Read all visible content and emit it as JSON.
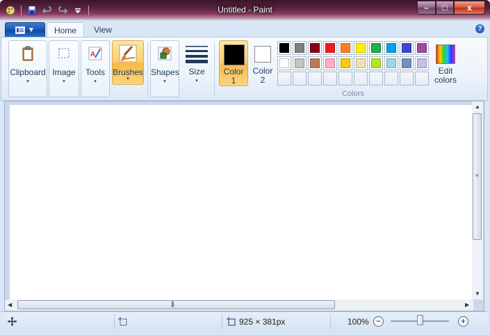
{
  "window": {
    "title": "Untitled - Paint"
  },
  "quick_access": {
    "items": [
      "paint-logo-icon",
      "save-icon",
      "undo-icon",
      "redo-icon",
      "customize-icon"
    ]
  },
  "window_controls": {
    "minimize": "–",
    "maximize": "□",
    "close": "x"
  },
  "ribbon_tabs": {
    "home": "Home",
    "view": "View"
  },
  "help_glyph": "?",
  "ribbon": {
    "clipboard": "Clipboard",
    "image": "Image",
    "tools": "Tools",
    "brushes": "Brushes",
    "shapes": "Shapes",
    "size": "Size",
    "color1": {
      "label": "Color",
      "num": "1",
      "value": "#000000"
    },
    "color2": {
      "label": "Color",
      "num": "2",
      "value": "#ffffff"
    },
    "colors_group": "Colors",
    "edit_colors": {
      "line1": "Edit",
      "line2": "colors"
    },
    "dropdown_glyph": "▾"
  },
  "palette": {
    "row1": [
      "#000000",
      "#7f7f7f",
      "#880015",
      "#ed1c24",
      "#ff7f27",
      "#fff200",
      "#22b14c",
      "#00a2e8",
      "#3f48cc",
      "#a349a4"
    ],
    "row2": [
      "#ffffff",
      "#c3c3c3",
      "#b97a57",
      "#ffaec9",
      "#ffc90e",
      "#efe4b0",
      "#b5e61d",
      "#99d9ea",
      "#7092be",
      "#c8bfe7"
    ],
    "row3_empty": 10
  },
  "status": {
    "canvas_size": "925 × 381px",
    "zoom": "100%",
    "zoom_level": 0.5,
    "zoom_out": "−",
    "zoom_in": "+"
  },
  "accent": {
    "active_button": "#fbcf6e",
    "app_menu": "#1c55b0"
  }
}
